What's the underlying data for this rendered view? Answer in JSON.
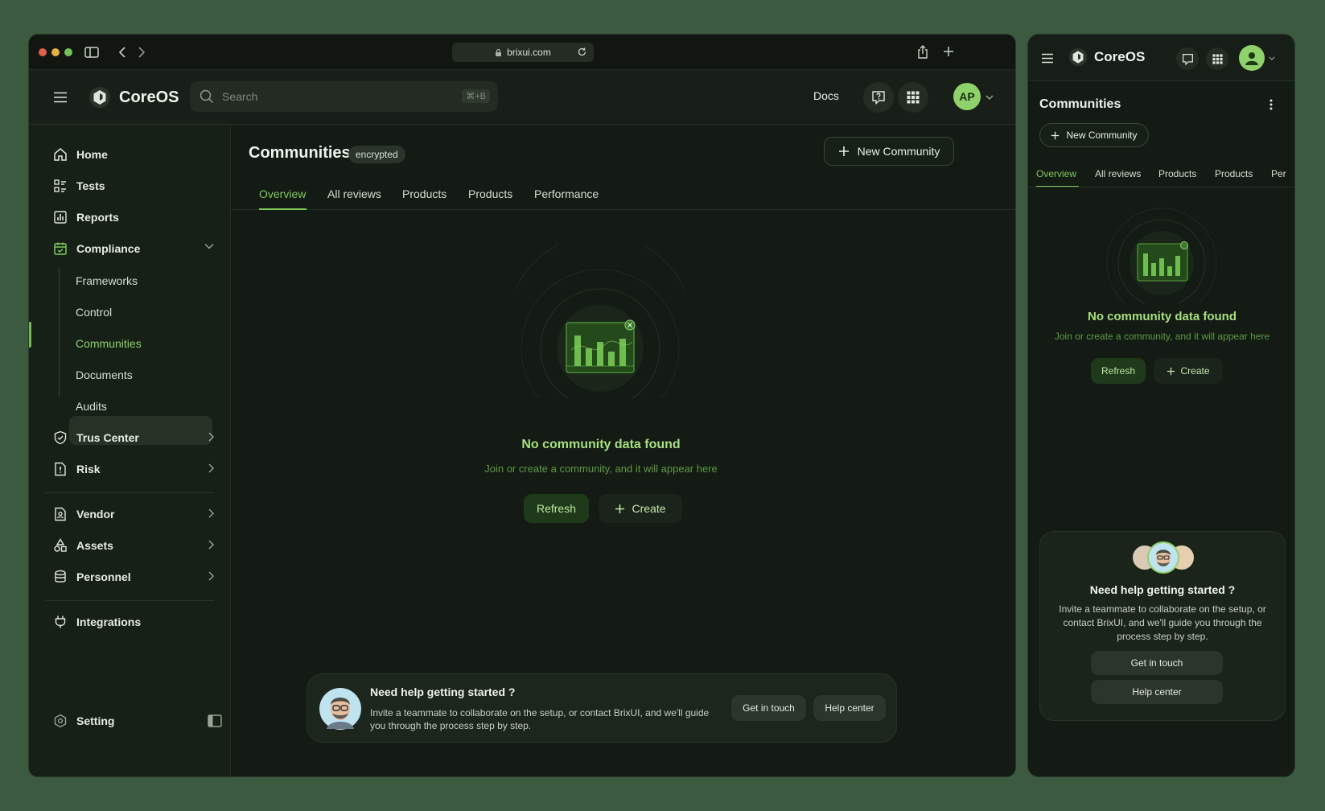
{
  "browser": {
    "url": "brixui.com"
  },
  "app": {
    "brand": "CoreOS",
    "search_placeholder": "Search",
    "search_shortcut": "⌘+B",
    "docs_label": "Docs",
    "avatar_initials": "AP"
  },
  "sidebar": {
    "items": [
      {
        "label": "Home",
        "icon": "home-icon"
      },
      {
        "label": "Tests",
        "icon": "list-icon"
      },
      {
        "label": "Reports",
        "icon": "chart-icon"
      },
      {
        "label": "Compliance",
        "icon": "calendar-check-icon"
      },
      {
        "label": "Trus Center",
        "icon": "shield-icon"
      },
      {
        "label": "Risk",
        "icon": "alert-file-icon"
      },
      {
        "label": "Vendor",
        "icon": "vendor-icon"
      },
      {
        "label": "Assets",
        "icon": "shapes-icon"
      },
      {
        "label": "Personnel",
        "icon": "database-icon"
      },
      {
        "label": "Integrations",
        "icon": "plug-icon"
      }
    ],
    "compliance_sub": [
      "Frameworks",
      "Control",
      "Communities",
      "Documents",
      "Audits"
    ],
    "setting_label": "Setting"
  },
  "main": {
    "title": "Communities",
    "badge": "encrypted",
    "new_button": "New Community",
    "tabs": [
      "Overview",
      "All reviews",
      "Products",
      "Products",
      "Performance"
    ],
    "empty_title": "No community data found",
    "empty_sub": "Join or create a community, and it will appear here",
    "refresh_label": "Refresh",
    "create_label": "Create"
  },
  "help": {
    "title": "Need help getting started ?",
    "text": "Invite a teammate to collaborate on the setup, or contact BrixUI, and we'll guide you through the process step by step.",
    "get_in_touch": "Get in touch",
    "help_center": "Help center"
  },
  "mobile": {
    "brand": "CoreOS",
    "title": "Communities",
    "new_button": "New Community",
    "tabs": [
      "Overview",
      "All reviews",
      "Products",
      "Products",
      "Per"
    ]
  },
  "colors": {
    "accent": "#7fcb58",
    "background": "#141a14",
    "page_background": "#3b5a3f"
  }
}
